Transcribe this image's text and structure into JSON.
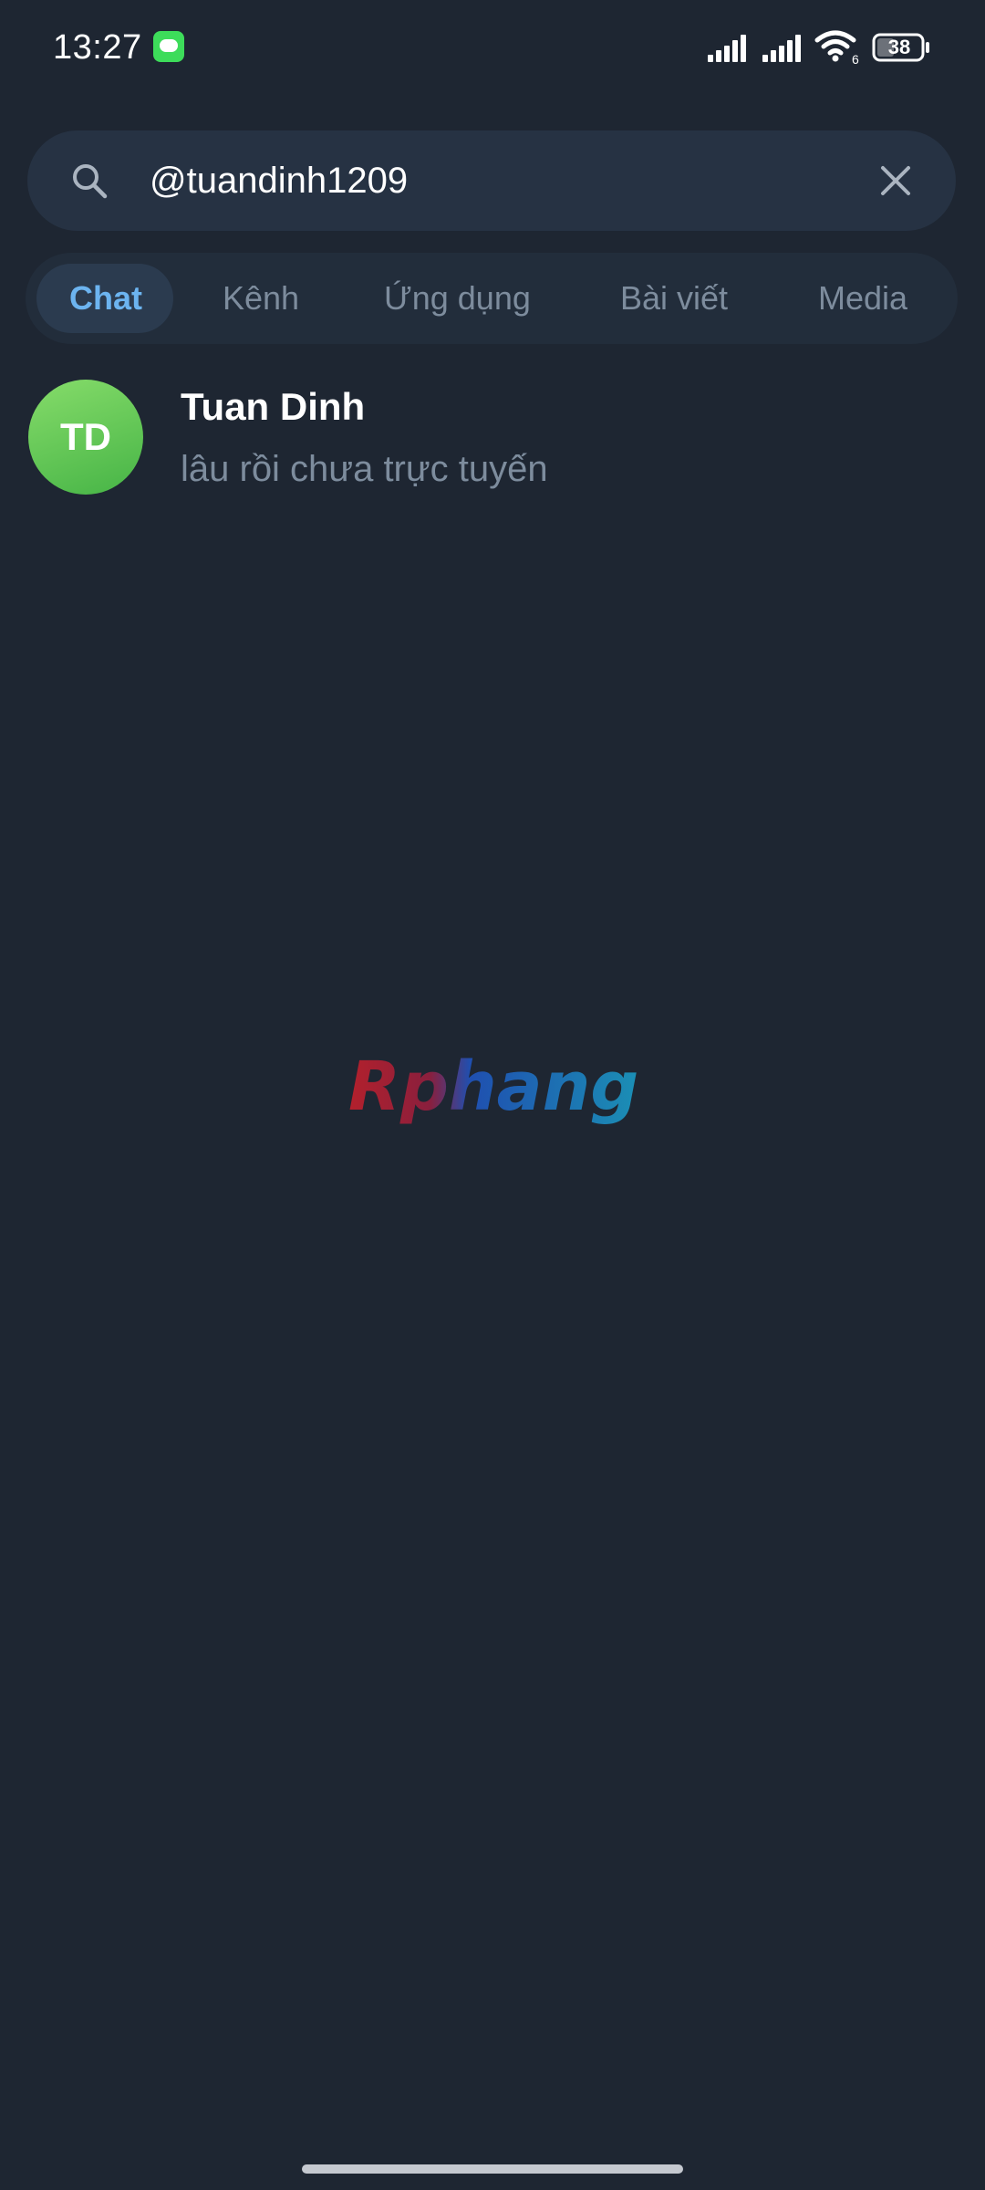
{
  "status_bar": {
    "time": "13:27",
    "battery": "38",
    "notification_icon": "messages-icon",
    "wifi_label": "6"
  },
  "search": {
    "query": "@tuandinh1209",
    "icon": "search-icon",
    "clear_icon": "close-icon"
  },
  "tabs": [
    {
      "label": "Chat",
      "active": true
    },
    {
      "label": "Kênh",
      "active": false
    },
    {
      "label": "Ứng dụng",
      "active": false
    },
    {
      "label": "Bài viết",
      "active": false
    },
    {
      "label": "Media",
      "active": false
    }
  ],
  "results": [
    {
      "initials": "TD",
      "name": "Tuan Dinh",
      "status": "lâu rồi chưa trực tuyến"
    }
  ],
  "watermark": {
    "text": "Rphang"
  },
  "colors": {
    "background": "#1e2632",
    "accent": "#6cb4f0",
    "secondary_text": "#7d8c9d",
    "avatar": "#5cc24e"
  }
}
